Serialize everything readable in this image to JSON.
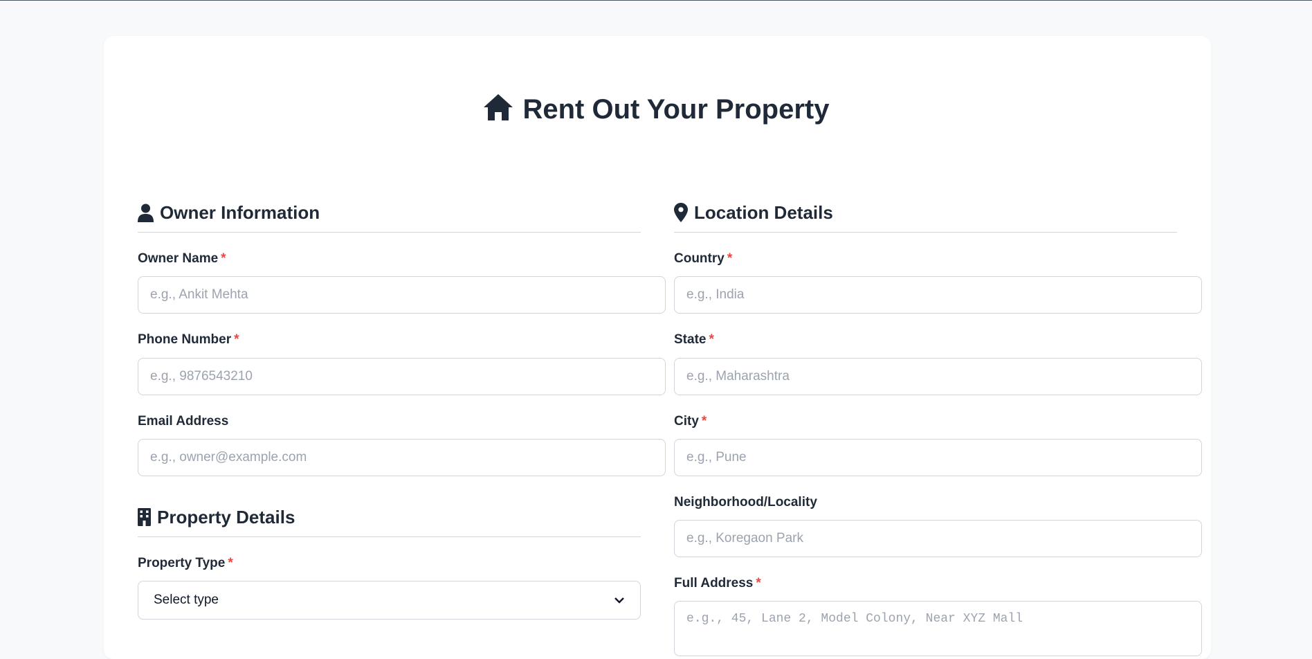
{
  "page": {
    "title": "Rent Out Your Property",
    "title_icon": "home-icon",
    "accent_required": "#ef4444",
    "text_color": "#1f2937"
  },
  "owner": {
    "heading": "Owner Information",
    "icon": "user-icon",
    "fields": [
      {
        "label": "Owner Name",
        "required": "*",
        "placeholder": "e.g., Ankit Mehta",
        "value": ""
      },
      {
        "label": "Phone Number",
        "required": "*",
        "placeholder": "e.g., 9876543210",
        "value": ""
      },
      {
        "label": "Email Address",
        "required": "",
        "placeholder": "e.g., owner@example.com",
        "value": ""
      }
    ]
  },
  "property": {
    "heading": "Property Details",
    "icon": "building-icon",
    "type_label": "Property Type",
    "type_required": "*",
    "type_selected": "Select type"
  },
  "location": {
    "heading": "Location Details",
    "icon": "map-pin-icon",
    "fields": [
      {
        "label": "Country",
        "required": "*",
        "placeholder": "e.g., India",
        "value": ""
      },
      {
        "label": "State",
        "required": "*",
        "placeholder": "e.g., Maharashtra",
        "value": ""
      },
      {
        "label": "City",
        "required": "*",
        "placeholder": "e.g., Pune",
        "value": ""
      },
      {
        "label": "Neighborhood/Locality",
        "required": "",
        "placeholder": "e.g., Koregaon Park",
        "value": ""
      },
      {
        "label": "Full Address",
        "required": "*",
        "placeholder": "e.g., 45, Lane 2, Model Colony, Near XYZ Mall",
        "value": ""
      }
    ]
  }
}
